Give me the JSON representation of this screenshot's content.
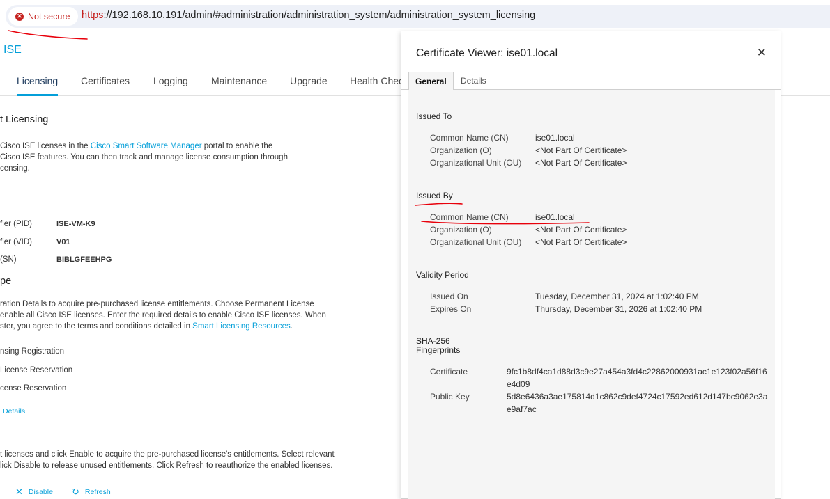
{
  "browser": {
    "security_label": "Not secure",
    "url_scheme": "https",
    "url_rest": "://192.168.10.191/admin/#administration/administration_system/administration_system_licensing"
  },
  "app": {
    "title": "ISE"
  },
  "tabs": [
    {
      "label": "Licensing"
    },
    {
      "label": "Certificates"
    },
    {
      "label": "Logging"
    },
    {
      "label": "Maintenance"
    },
    {
      "label": "Upgrade"
    },
    {
      "label": "Health Chec"
    }
  ],
  "licensing": {
    "heading": "t Licensing",
    "intro_line1_a": "Cisco ISE licenses in the ",
    "intro_link": "Cisco Smart Software Manager",
    "intro_line1_b": " portal to enable the",
    "intro_line2": " Cisco ISE features. You can then track and manage license consumption through",
    "intro_line3": "censing.",
    "info": [
      {
        "label": "fier (PID)",
        "value": "ISE-VM-K9"
      },
      {
        "label": "fier (VID)",
        "value": "V01"
      },
      {
        "label": " (SN)",
        "value": "BIBLGFEEHPG"
      }
    ],
    "type_heading": "pe",
    "type_line1": "ration Details to acquire pre-purchased license entitlements. Choose Permanent License",
    "type_line2": " enable all Cisco ISE licenses. Enter the required details to enable Cisco ISE licenses. When",
    "type_line3_a": "ster, you agree to the terms and conditions detailed in ",
    "type_link": "Smart Licensing Resources",
    "type_line3_b": ".",
    "options": [
      {
        "label": "nsing Registration"
      },
      {
        "label": " License Reservation"
      },
      {
        "label": "cense Reservation"
      }
    ],
    "details_link": "Details",
    "ent_line1": "t licenses and click Enable to acquire the pre-purchased license's entitlements. Select relevant",
    "ent_line2": "lick Disable to release unused entitlements. Click Refresh to reauthorize the enabled licenses.",
    "disable_label": "Disable",
    "refresh_label": "Refresh"
  },
  "viewer": {
    "title": "Certificate Viewer: ise01.local",
    "close_glyph": "✕",
    "tabs": {
      "general": "General",
      "details": "Details"
    },
    "issued_to": {
      "heading": "Issued To",
      "fields": [
        {
          "label": "Common Name (CN)",
          "value": "ise01.local"
        },
        {
          "label": "Organization (O)",
          "value": "<Not Part Of Certificate>"
        },
        {
          "label": "Organizational Unit (OU)",
          "value": "<Not Part Of Certificate>"
        }
      ]
    },
    "issued_by": {
      "heading": "Issued By",
      "fields": [
        {
          "label": "Common Name (CN)",
          "value": "ise01.local"
        },
        {
          "label": "Organization (O)",
          "value": "<Not Part Of Certificate>"
        },
        {
          "label": "Organizational Unit (OU)",
          "value": "<Not Part Of Certificate>"
        }
      ]
    },
    "validity": {
      "heading": "Validity Period",
      "fields": [
        {
          "label": "Issued On",
          "value": "Tuesday, December 31, 2024 at 1:02:40 PM"
        },
        {
          "label": "Expires On",
          "value": "Thursday, December 31, 2026 at 1:02:40 PM"
        }
      ]
    },
    "fingerprints": {
      "heading_line1": "SHA-256",
      "heading_line2": "Fingerprints",
      "fields": [
        {
          "label": "Certificate",
          "value": "9fc1b8df4ca1d88d3c9e27a454a3fd4c22862000931ac1e123f02a56f16e4d09"
        },
        {
          "label": "Public Key",
          "value": "5d8e6436a3ae175814d1c862c9def4724c17592ed612d147bc9062e3ae9af7ac"
        }
      ]
    }
  },
  "colors": {
    "accent": "#049fd9",
    "annotation": "#e8000b",
    "warning": "#c5221f"
  }
}
